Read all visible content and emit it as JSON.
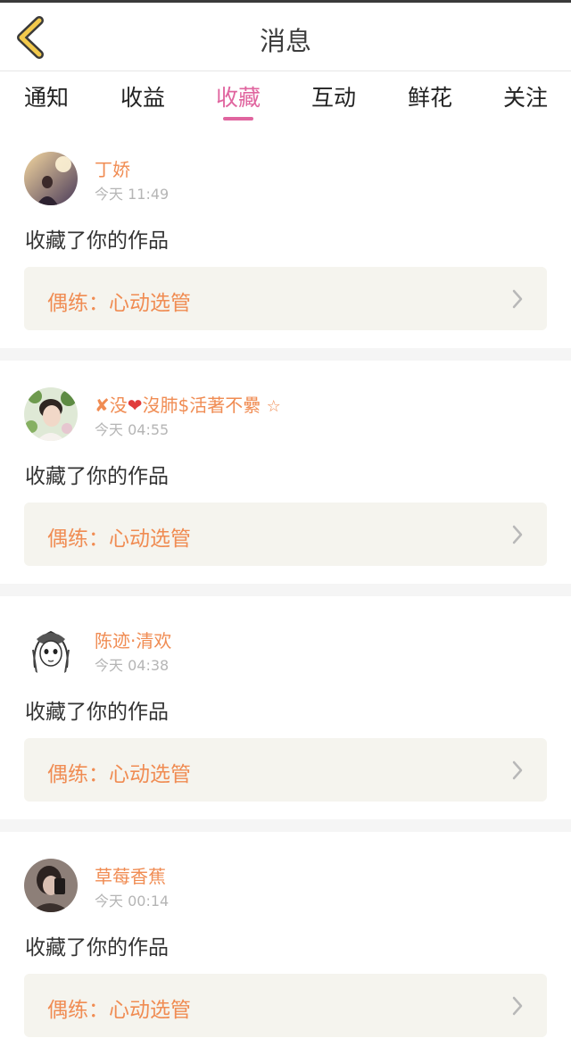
{
  "header": {
    "title": "消息"
  },
  "tabs": [
    {
      "label": "通知"
    },
    {
      "label": "收益"
    },
    {
      "label": "收藏"
    },
    {
      "label": "互动"
    },
    {
      "label": "鲜花"
    },
    {
      "label": "关注"
    }
  ],
  "active_tab": "收藏",
  "colors": {
    "accent": "#e0659f",
    "name": "#f08c53",
    "card_bg": "#f5f4ee"
  },
  "items": [
    {
      "user": "丁娇",
      "time": "今天 11:49",
      "action": "收藏了你的作品",
      "work": "偶练：心动选管"
    },
    {
      "user_prefix": "✘没",
      "user_heart": "❤",
      "user_rest": "沒肺$活著不纍",
      "user_star": "☆",
      "time": "今天 04:55",
      "action": "收藏了你的作品",
      "work": "偶练：心动选管"
    },
    {
      "user": "陈迹·清欢",
      "time": "今天 04:38",
      "action": "收藏了你的作品",
      "work": "偶练：心动选管"
    },
    {
      "user": "草莓香蕉",
      "time": "今天 00:14",
      "action": "收藏了你的作品",
      "work": "偶练：心动选管"
    }
  ]
}
